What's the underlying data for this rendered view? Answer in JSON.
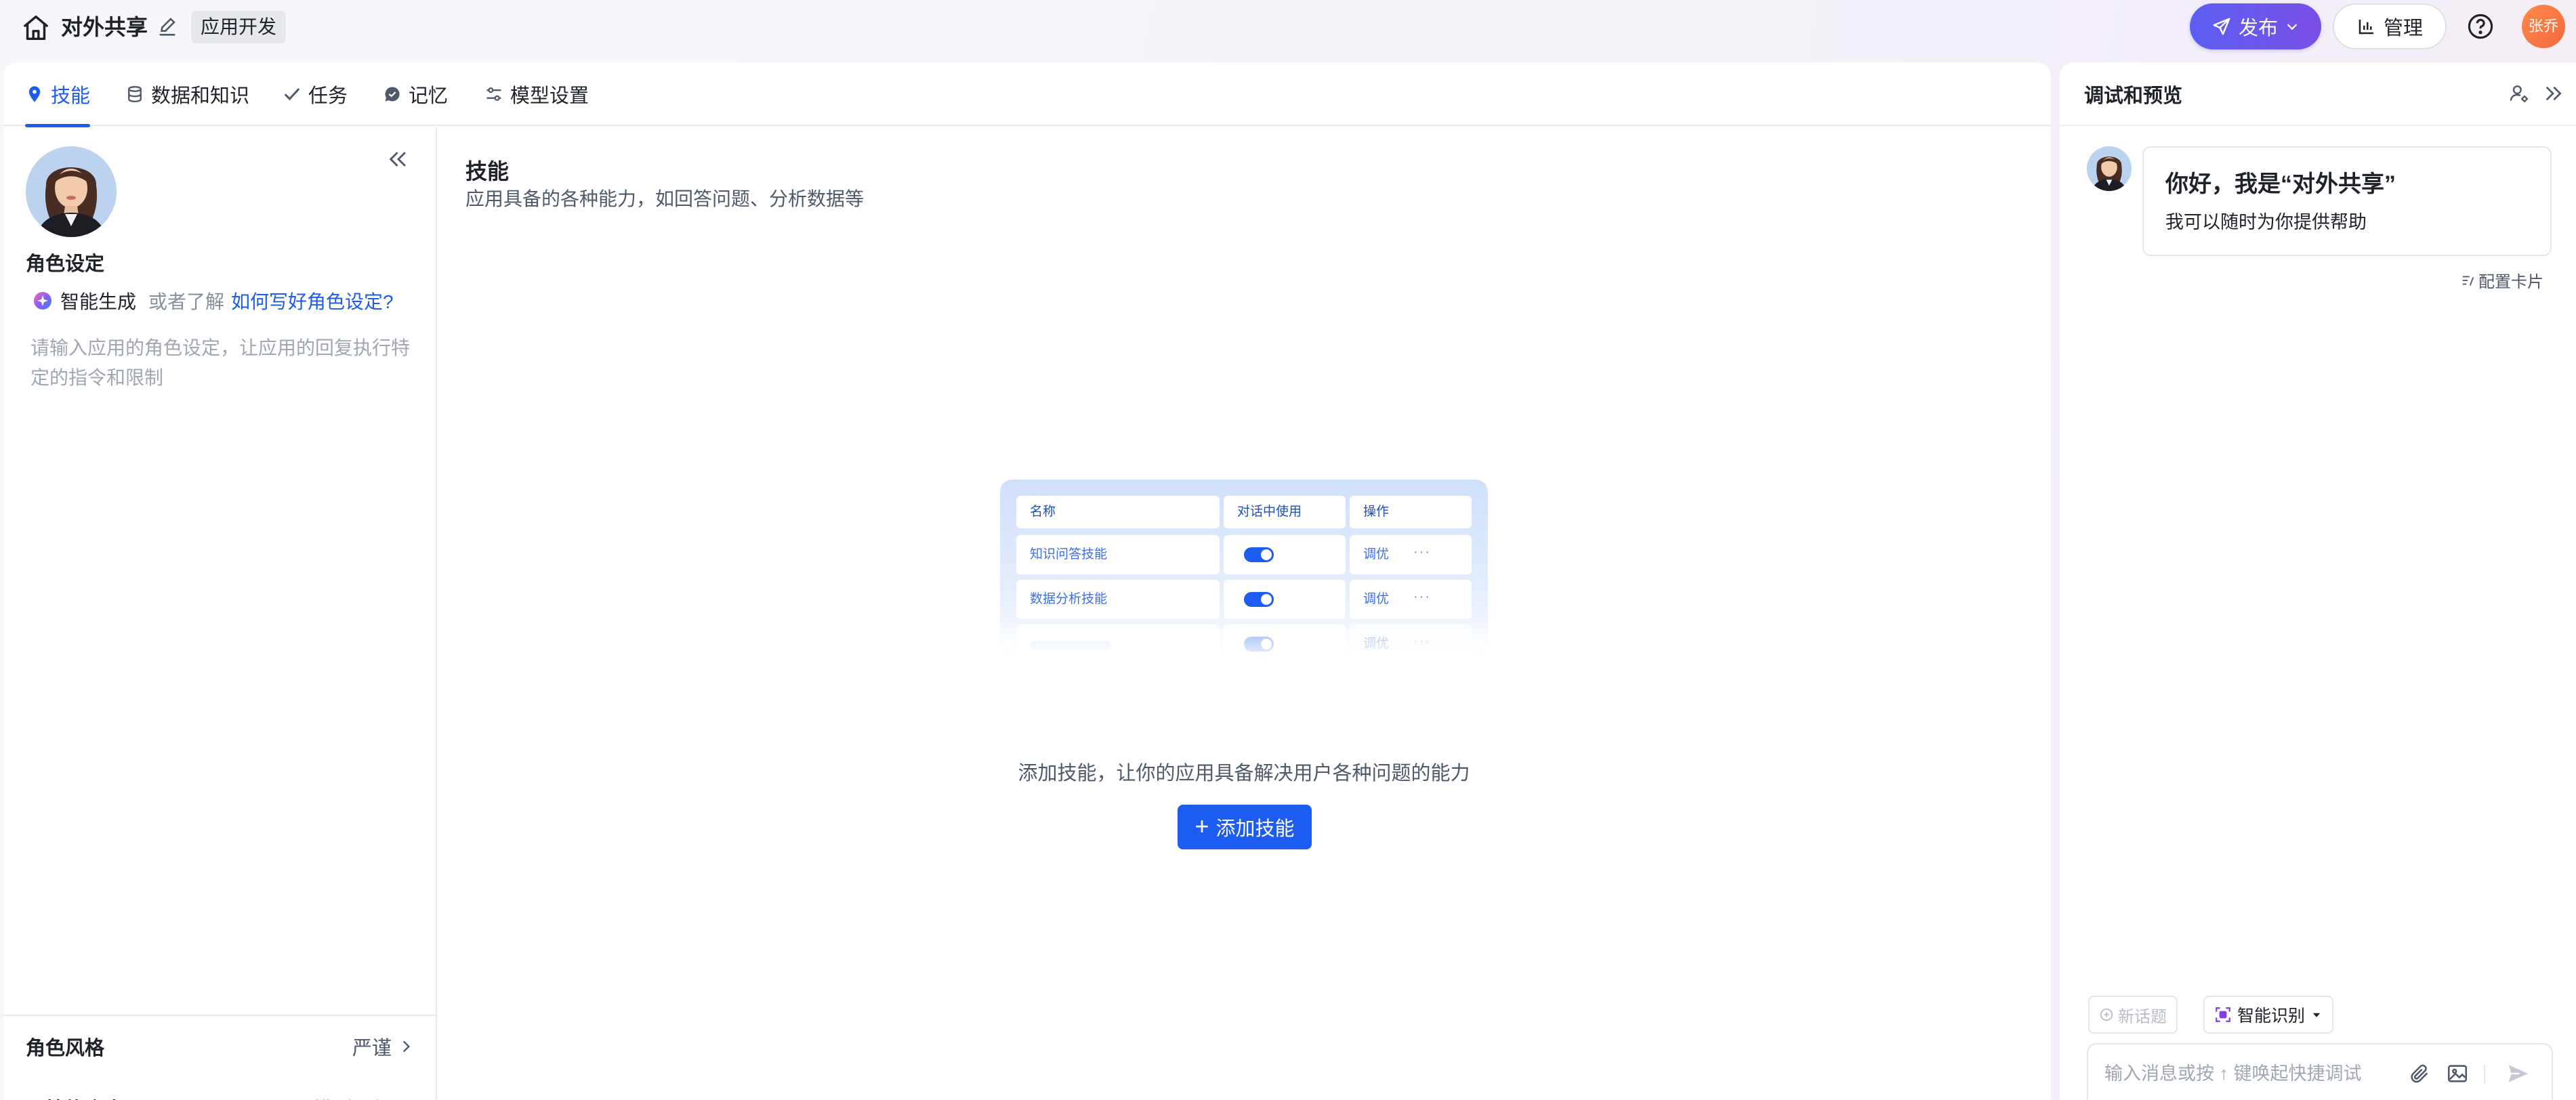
{
  "header": {
    "title": "对外共享",
    "tag": "应用开发",
    "publish_label": "发布",
    "manage_label": "管理",
    "user_name": "张乔"
  },
  "tabs": [
    {
      "label": "技能",
      "icon": "pin-icon",
      "active": true
    },
    {
      "label": "数据和知识",
      "icon": "database-icon",
      "active": false
    },
    {
      "label": "任务",
      "icon": "check-icon",
      "active": false
    },
    {
      "label": "记忆",
      "icon": "chat-icon",
      "active": false
    },
    {
      "label": "模型设置",
      "icon": "sliders-icon",
      "active": false
    }
  ],
  "persona": {
    "section_title": "角色设定",
    "smart_generate": "智能生成",
    "or_text": "或者了解",
    "how_link": "如何写好角色设定?",
    "placeholder": "请输入应用的角色设定，让应用的回复执行特定的指令和限制",
    "style_label": "角色风格",
    "style_value": "严谨",
    "noskill_label": "无技能命中配置",
    "noskill_value": "模型回复"
  },
  "skills": {
    "title": "技能",
    "subtitle": "应用具备的各种能力，如回答问题、分析数据等",
    "illustration": {
      "headers": [
        "名称",
        "对话中使用",
        "操作"
      ],
      "rows": [
        {
          "name": "知识问答技能",
          "action": "调优",
          "more": "···"
        },
        {
          "name": "数据分析技能",
          "action": "调优",
          "more": "···"
        },
        {
          "name": "",
          "action": "调优",
          "more": "···"
        }
      ]
    },
    "empty_text": "添加技能，让你的应用具备解决用户各种问题的能力",
    "add_button": "添加技能"
  },
  "preview": {
    "title": "调试和预览",
    "greeting_title": "你好，我是“对外共享”",
    "greeting_sub": "我可以随时为你提供帮助",
    "config_card": "配置卡片",
    "new_topic": "新话题",
    "smart_recog": "智能识别",
    "input_placeholder": "输入消息或按 ↑ 键唤起快捷调试"
  },
  "colors": {
    "accent": "#1c5cf0",
    "publish_gradient_start": "#5b5ff2",
    "publish_gradient_end": "#7a4fe6",
    "avatar": "#f26a3d"
  }
}
